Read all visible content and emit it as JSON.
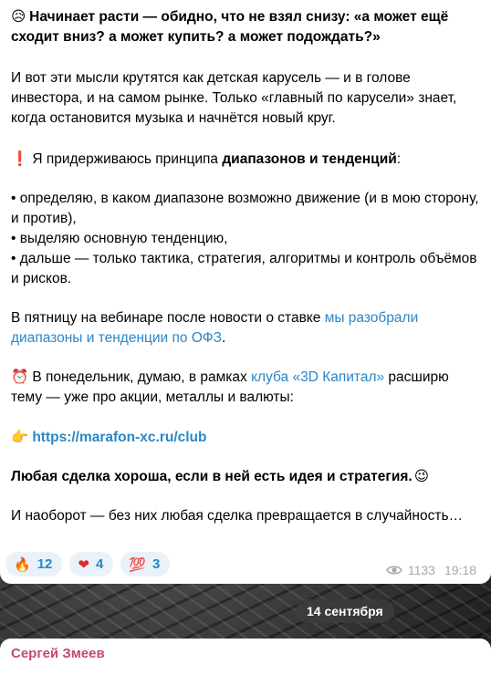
{
  "message": {
    "p1_emoji": "😥",
    "p1_text": "Начинает расти — обидно, что не взял снизу: «а может ещё сходит вниз? а может купить? а может подождать?»",
    "p2": "И вот эти мысли крутятся как детская карусель — и в голове инвестора, и на самом рынке. Только «главный по карусели» знает, когда остановится музыка и начнётся новый круг.",
    "p3_emoji": "❗",
    "p3_text": "Я придерживаюсь принципа ",
    "p3_bold": "диапазонов и тенденций",
    "p3_end": ":",
    "bullets": [
      " • определяю, в каком диапазоне возможно движение (и в мою сторону, и против),",
      " • выделяю основную тенденцию,",
      " • дальше — только тактика, стратегия, алгоритмы и контроль объёмов и рисков."
    ],
    "p5_text": "В пятницу на вебинаре после новости о ставке ",
    "p5_link": "мы разобрали диапазоны и тенденции по ОФЗ",
    "p5_end": ".",
    "p6_emoji": "⏰",
    "p6_text": "В понедельник, думаю, в рамках ",
    "p6_link": "клуба «3D Капитал»",
    "p6_end": " расширю тему — уже про акции, металлы и валюты:",
    "p7_emoji": "👉",
    "p7_link": "https://marafon-xc.ru/club",
    "p8_bold": "Любая сделка хороша, если в ней есть идея и стратегия.",
    "p8_emoji": "😉",
    "p9": "И наоборот — без них любая сделка превращается в случайность…"
  },
  "reactions": [
    {
      "emoji": "🔥",
      "count": "12"
    },
    {
      "emoji": "❤",
      "count": "4"
    },
    {
      "emoji": "💯",
      "count": "3"
    }
  ],
  "views": "1133",
  "time": "19:18",
  "date_divider": "14 сентября",
  "next_message": {
    "sender": "Сергей Змеев"
  },
  "colors": {
    "link": "#2a86c8",
    "sender": "#c2477a",
    "reaction_bg": "#e9f2fa"
  }
}
